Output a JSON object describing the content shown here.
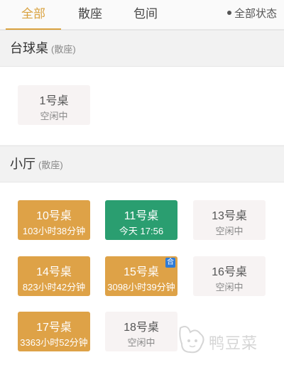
{
  "tabs": [
    {
      "label": "全部",
      "active": true
    },
    {
      "label": "散座",
      "active": false
    },
    {
      "label": "包间",
      "active": false
    }
  ],
  "status_filter": {
    "label": "全部状态"
  },
  "sections": [
    {
      "title": "台球桌",
      "subtitle": "(散座)",
      "tables": [
        {
          "name": "1号桌",
          "status": "空闲中",
          "state": "free"
        }
      ]
    },
    {
      "title": "小厅",
      "subtitle": "(散座)",
      "tables": [
        {
          "name": "10号桌",
          "status": "103小时38分钟",
          "state": "busy"
        },
        {
          "name": "11号桌",
          "status": "今天 17:56",
          "state": "open"
        },
        {
          "name": "13号桌",
          "status": "空闲中",
          "state": "free"
        },
        {
          "name": "14号桌",
          "status": "823小时42分钟",
          "state": "busy"
        },
        {
          "name": "15号桌",
          "status": "3098小时39分钟",
          "state": "busy",
          "badge": "合"
        },
        {
          "name": "16号桌",
          "status": "空闲中",
          "state": "free"
        },
        {
          "name": "17号桌",
          "status": "3363小时52分钟",
          "state": "busy"
        },
        {
          "name": "18号桌",
          "status": "空闲中",
          "state": "free"
        }
      ]
    }
  ],
  "watermark": {
    "text": "鸭豆菜",
    "icon": "cartoon-mascot-icon"
  },
  "colors": {
    "accent": "#d9a23f",
    "busy": "#dea247",
    "open": "#2a9e70",
    "free": "#f7f3f3",
    "badge": "#2f7bd6"
  }
}
